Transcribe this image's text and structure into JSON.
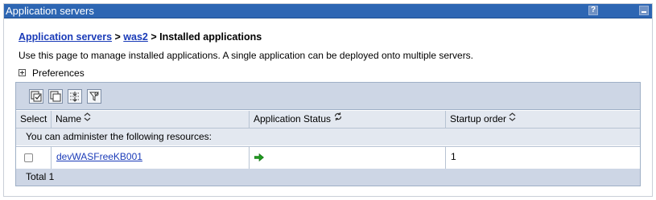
{
  "portlet": {
    "title": "Application servers",
    "help_label": "?"
  },
  "breadcrumb": {
    "link1": "Application servers",
    "sep1": " > ",
    "link2": "was2",
    "sep2": " > ",
    "current": "Installed applications"
  },
  "description": "Use this page to manage installed applications. A single application can be deployed onto multiple servers.",
  "preferences_label": "Preferences",
  "toolbar": {
    "buttons": [
      "select-all-icon",
      "deselect-all-icon",
      "expand-all-icon",
      "filter-icon"
    ]
  },
  "table": {
    "columns": {
      "select": "Select",
      "name": "Name",
      "status": "Application Status",
      "startup": "Startup order"
    },
    "group_label": "You can administer the following resources:",
    "rows": [
      {
        "name": "devWASFreeKB001",
        "status_icon": "started-arrow-icon",
        "startup_order": "1"
      }
    ],
    "total": "Total 1"
  },
  "colors": {
    "titlebar": "#2d66b3",
    "link": "#1a3bb8",
    "toolbar_bg": "#cdd6e5",
    "header_bg": "#e3e8f0",
    "status_started": "#1f9a1f"
  }
}
